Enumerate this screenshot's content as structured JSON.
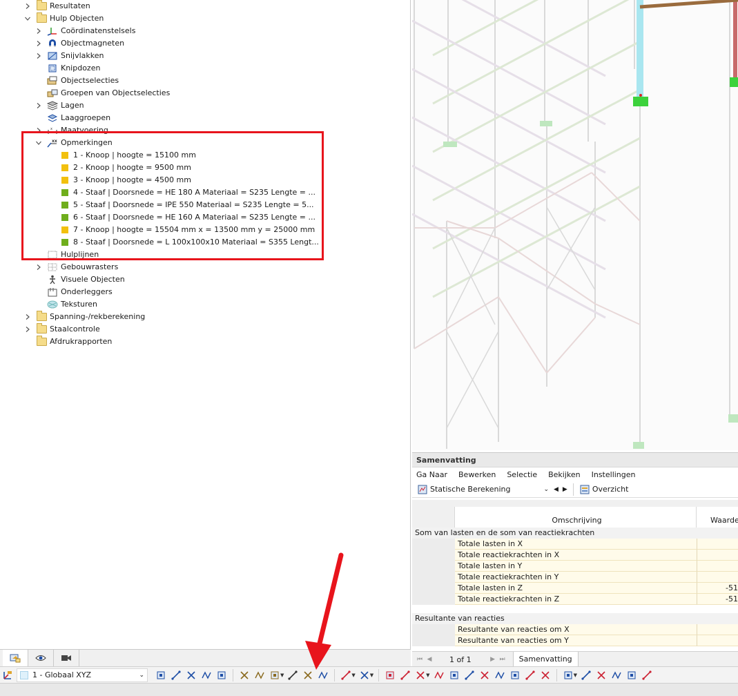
{
  "navigator": {
    "items": [
      {
        "label": "Resultaten",
        "level": 0,
        "expand": "collapsed",
        "icon": "folder-icon"
      },
      {
        "label": "Hulp Objecten",
        "level": 0,
        "expand": "expanded",
        "icon": "folder-icon"
      },
      {
        "label": "Coördinatenstelsels",
        "level": 1,
        "expand": "collapsed",
        "icon": "coordinate-axes-icon"
      },
      {
        "label": "Objectmagneten",
        "level": 1,
        "expand": "collapsed",
        "icon": "magnet-icon"
      },
      {
        "label": "Snijvlakken",
        "level": 1,
        "expand": "collapsed",
        "icon": "section-plane-icon"
      },
      {
        "label": "Knipdozen",
        "level": 1,
        "expand": "none",
        "icon": "clipping-box-icon"
      },
      {
        "label": "Objectselecties",
        "level": 1,
        "expand": "none",
        "icon": "object-selection-icon"
      },
      {
        "label": "Groepen van Objectselecties",
        "level": 1,
        "expand": "none",
        "icon": "selection-groups-icon"
      },
      {
        "label": "Lagen",
        "level": 1,
        "expand": "collapsed",
        "icon": "layers-icon"
      },
      {
        "label": "Laaggroepen",
        "level": 1,
        "expand": "none",
        "icon": "layer-groups-icon"
      },
      {
        "label": "Maatvoering",
        "level": 1,
        "expand": "collapsed",
        "icon": "dimension-icon"
      },
      {
        "label": "Opmerkingen",
        "level": 1,
        "expand": "expanded",
        "icon": "comment-xx-icon"
      },
      {
        "label": "1 - Knoop | hoogte = 15100 mm",
        "level": 2,
        "expand": "none",
        "icon": "yellow-square-icon"
      },
      {
        "label": "2 - Knoop | hoogte = 9500 mm",
        "level": 2,
        "expand": "none",
        "icon": "yellow-square-icon"
      },
      {
        "label": "3 - Knoop | hoogte = 4500 mm",
        "level": 2,
        "expand": "none",
        "icon": "yellow-square-icon"
      },
      {
        "label": "4 - Staaf | Doorsnede = HE 180 A Materiaal = S235 Lengte = ...",
        "level": 2,
        "expand": "none",
        "icon": "green-square-icon"
      },
      {
        "label": "5 - Staaf | Doorsnede = IPE 550 Materiaal = S235 Lengte = 5...",
        "level": 2,
        "expand": "none",
        "icon": "green-square-icon"
      },
      {
        "label": "6 - Staaf | Doorsnede = HE 160 A Materiaal = S235 Lengte = ...",
        "level": 2,
        "expand": "none",
        "icon": "green-square-icon"
      },
      {
        "label": "7 - Knoop | hoogte = 15504 mm x = 13500 mm y = 25000 mm",
        "level": 2,
        "expand": "none",
        "icon": "yellow-square-icon"
      },
      {
        "label": "8 - Staaf | Doorsnede = L 100x100x10 Materiaal = S355 Lengt...",
        "level": 2,
        "expand": "none",
        "icon": "green-square-icon"
      },
      {
        "label": "Hulplijnen",
        "level": 1,
        "expand": "none",
        "icon": "guidelines-icon"
      },
      {
        "label": "Gebouwrasters",
        "level": 1,
        "expand": "collapsed",
        "icon": "building-grid-icon"
      },
      {
        "label": "Visuele Objecten",
        "level": 1,
        "expand": "none",
        "icon": "visual-object-person-icon"
      },
      {
        "label": "Onderleggers",
        "level": 1,
        "expand": "none",
        "icon": "background-layer-icon"
      },
      {
        "label": "Teksturen",
        "level": 1,
        "expand": "none",
        "icon": "texture-icon"
      },
      {
        "label": "Spanning-/rekberekening",
        "level": 0,
        "expand": "collapsed",
        "icon": "folder-icon"
      },
      {
        "label": "Staalcontrole",
        "level": 0,
        "expand": "collapsed",
        "icon": "folder-icon"
      },
      {
        "label": "Afdrukrapporten",
        "level": 0,
        "expand": "none",
        "icon": "folder-icon"
      }
    ],
    "tabs": [
      {
        "name": "data-tab",
        "icon": "navigator-data-icon",
        "active": true
      },
      {
        "name": "display-tab",
        "icon": "eye-icon",
        "active": false
      },
      {
        "name": "views-tab",
        "icon": "video-camera-icon",
        "active": false
      }
    ]
  },
  "summary": {
    "title": "Samenvatting",
    "menu": [
      "Ga Naar",
      "Bewerken",
      "Selectie",
      "Bekijken",
      "Instellingen"
    ],
    "analysis_combo": "Statische Berekening",
    "overview_label": "Overzicht",
    "columns": {
      "description": "Omschrijving",
      "value": "Waarde"
    },
    "groups": [
      {
        "title": "Som van lasten en de som van reactiekrachten",
        "rows": [
          {
            "label": "Totale lasten in X",
            "value": ""
          },
          {
            "label": "Totale reactiekrachten in X",
            "value": ""
          },
          {
            "label": "Totale lasten in Y",
            "value": ""
          },
          {
            "label": "Totale reactiekrachten in Y",
            "value": ""
          },
          {
            "label": "Totale lasten in Z",
            "value": "-51"
          },
          {
            "label": "Totale reactiekrachten in Z",
            "value": "-51"
          }
        ]
      },
      {
        "title": "Resultante van reacties",
        "rows": [
          {
            "label": "Resultante van reacties om X",
            "value": ""
          },
          {
            "label": "Resultante van reacties om Y",
            "value": ""
          }
        ]
      }
    ],
    "pager": {
      "text": "1 of 1",
      "tab": "Samenvatting"
    }
  },
  "bottom_toolbar": {
    "coordinate_system": "1 - Globaal XYZ"
  },
  "colors": {
    "highlight": "#e8141c",
    "yellow_item": "#f2c00e",
    "green_item": "#6fae1c",
    "support_green": "#3cd23c"
  }
}
